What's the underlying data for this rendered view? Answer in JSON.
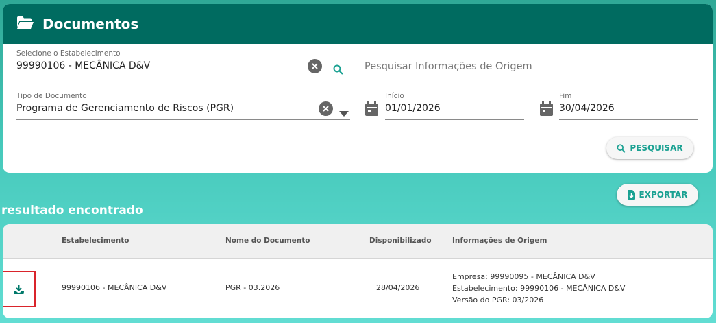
{
  "header": {
    "title": "Documentos",
    "icon": "folder-open-icon"
  },
  "filters": {
    "establishment": {
      "label": "Selecione o Estabelecimento",
      "value": "99990106 - MECÂNICA D&V"
    },
    "origin_search": {
      "placeholder": "Pesquisar Informações de Origem"
    },
    "doc_type": {
      "label": "Tipo de Documento",
      "value": "Programa de Gerenciamento de Riscos (PGR)"
    },
    "start": {
      "label": "Início",
      "value": "01/01/2026"
    },
    "end": {
      "label": "Fim",
      "value": "30/04/2026"
    },
    "search_button": "PESQUISAR"
  },
  "export_button": "EXPORTAR",
  "results_title": "resultado encontrado",
  "table": {
    "columns": [
      "Estabelecimento",
      "Nome do Documento",
      "Disponibilizado",
      "Informações de Origem"
    ],
    "rows": [
      {
        "establishment": "99990106 - MECÂNICA D&V",
        "document_name": "PGR - 03.2026",
        "available": "28/04/2026",
        "origin": [
          "Empresa: 99990095 - MECÂNICA D&V",
          "Estabelecimento: 99990106 - MECÂNICA D&V",
          "Versão do PGR: 03/2026"
        ]
      }
    ]
  },
  "colors": {
    "header": "#006b60",
    "accent": "#1aa192",
    "highlight": "#d9242b"
  }
}
